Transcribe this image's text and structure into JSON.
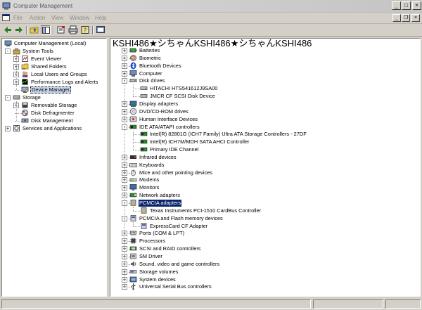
{
  "window": {
    "title": "Computer Management",
    "caption_buttons": {
      "minimize": "_",
      "maximize": "□",
      "close": "×"
    },
    "mdi_buttons": {
      "minimize": "_",
      "restore": "❐",
      "close": "×"
    }
  },
  "menu": [
    "File",
    "Action",
    "View",
    "Window",
    "Help"
  ],
  "toolbar": [
    {
      "icon": "back-arrow-icon",
      "interactable": true
    },
    {
      "icon": "forward-arrow-icon",
      "interactable": true
    },
    {
      "icon": "up-folder-icon",
      "interactable": true
    },
    {
      "icon": "show-hide-tree-icon",
      "interactable": true
    },
    {
      "icon": "properties-icon",
      "interactable": true
    },
    {
      "icon": "print-icon",
      "interactable": true
    },
    {
      "icon": "help-icon",
      "interactable": true
    },
    {
      "icon": "console-view-icon",
      "interactable": true
    }
  ],
  "left_tree": {
    "root": "Computer Management (Local)",
    "groups": [
      {
        "label": "System Tools",
        "children": [
          "Event Viewer",
          "Shared Folders",
          "Local Users and Groups",
          "Performance Logs and Alerts",
          "Device Manager"
        ],
        "child_expand": [
          true,
          true,
          true,
          true,
          false
        ],
        "selected_child": 4
      },
      {
        "label": "Storage",
        "children": [
          "Removable Storage",
          "Disk Defragmenter",
          "Disk Management"
        ],
        "child_expand": [
          true,
          false,
          false
        ]
      },
      {
        "label": "Services and Applications",
        "children": []
      }
    ]
  },
  "device_tree": {
    "computer_name": "KSHI486★シちゃんKSHI486★シちゃんKSHI486",
    "categories": [
      {
        "label": "Batteries",
        "icon": "battery-icon",
        "expanded": false,
        "children": []
      },
      {
        "label": "Biometric",
        "icon": "fingerprint-icon",
        "expanded": false,
        "children": []
      },
      {
        "label": "Bluetooth Devices",
        "icon": "bluetooth-icon",
        "expanded": false,
        "children": []
      },
      {
        "label": "Computer",
        "icon": "computer-icon",
        "expanded": false,
        "children": []
      },
      {
        "label": "Disk drives",
        "icon": "disk-drive-icon",
        "expanded": true,
        "children": [
          "HITACHI HTS541612J9SA00",
          "JMCR CF SCSI Disk Device"
        ]
      },
      {
        "label": "Display adapters",
        "icon": "display-adapter-icon",
        "expanded": false,
        "children": []
      },
      {
        "label": "DVD/CD-ROM drives",
        "icon": "cd-drive-icon",
        "expanded": false,
        "children": []
      },
      {
        "label": "Human Interface Devices",
        "icon": "hid-icon",
        "expanded": false,
        "children": []
      },
      {
        "label": "IDE ATA/ATAPI controllers",
        "icon": "ide-controller-icon",
        "expanded": true,
        "children": [
          "Intel(R) 82801G (ICH7 Family) Ultra ATA Storage Controllers - 27DF",
          "Intel(R) ICH7M/MDH SATA AHCI Controller",
          "Primary IDE Channel"
        ]
      },
      {
        "label": "Infrared devices",
        "icon": "infrared-icon",
        "expanded": false,
        "children": []
      },
      {
        "label": "Keyboards",
        "icon": "keyboard-icon",
        "expanded": false,
        "children": []
      },
      {
        "label": "Mice and other pointing devices",
        "icon": "mouse-icon",
        "expanded": false,
        "children": []
      },
      {
        "label": "Modems",
        "icon": "modem-icon",
        "expanded": false,
        "children": []
      },
      {
        "label": "Monitors",
        "icon": "monitor-icon",
        "expanded": false,
        "children": []
      },
      {
        "label": "Network adapters",
        "icon": "network-adapter-icon",
        "expanded": false,
        "children": []
      },
      {
        "label": "PCMCIA adapters",
        "icon": "pcmcia-icon",
        "expanded": true,
        "highlighted": true,
        "children": [
          "Texas Instruments PCI-1510 CardBus Controller"
        ]
      },
      {
        "label": "PCMCIA and Flash memory devices",
        "icon": "flash-memory-icon",
        "expanded": true,
        "children": [
          "ExpressCard CF Adapter"
        ]
      },
      {
        "label": "Ports (COM & LPT)",
        "icon": "port-icon",
        "expanded": false,
        "children": []
      },
      {
        "label": "Processors",
        "icon": "processor-icon",
        "expanded": false,
        "children": []
      },
      {
        "label": "SCSI and RAID controllers",
        "icon": "scsi-controller-icon",
        "expanded": false,
        "children": []
      },
      {
        "label": "SM Driver",
        "icon": "sm-driver-icon",
        "expanded": false,
        "children": []
      },
      {
        "label": "Sound, video and game controllers",
        "icon": "sound-icon",
        "expanded": false,
        "children": []
      },
      {
        "label": "Storage volumes",
        "icon": "storage-volume-icon",
        "expanded": false,
        "children": []
      },
      {
        "label": "System devices",
        "icon": "system-device-icon",
        "expanded": false,
        "children": []
      },
      {
        "label": "Universal Serial Bus controllers",
        "icon": "usb-icon",
        "expanded": false,
        "children": []
      }
    ]
  },
  "colors": {
    "selection": "#0a246a",
    "face": "#d4d0c8",
    "pane": "#ffffff"
  }
}
